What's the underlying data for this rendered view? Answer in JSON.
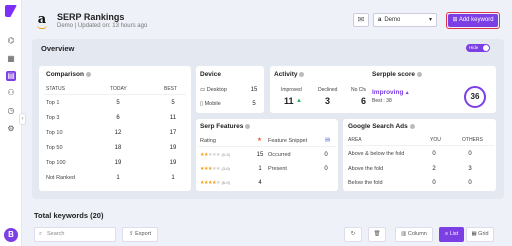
{
  "header": {
    "title": "SERP Rankings",
    "subtitle": "Demo | Updated on: 13 hours ago",
    "project_select": "Demo",
    "add_keyword_label": "Add keyword"
  },
  "overview": {
    "title": "Overview",
    "hide_label": "Hide"
  },
  "comparison": {
    "title": "Comparison",
    "headers": [
      "STATUS",
      "TODAY",
      "BEST"
    ],
    "rows": [
      {
        "status": "Top 1",
        "today": "5",
        "best": "5"
      },
      {
        "status": "Top 3",
        "today": "6",
        "best": "11"
      },
      {
        "status": "Top 10",
        "today": "12",
        "best": "17"
      },
      {
        "status": "Top 50",
        "today": "18",
        "best": "19"
      },
      {
        "status": "Top 100",
        "today": "19",
        "best": "19"
      },
      {
        "status": "Not Ranked",
        "today": "1",
        "best": "1"
      }
    ]
  },
  "device": {
    "title": "Device",
    "rows": [
      {
        "label": "Desktop",
        "value": "15"
      },
      {
        "label": "Mobile",
        "value": "5"
      }
    ]
  },
  "activity": {
    "title": "Activity",
    "improved_label": "Improved",
    "improved_value": "11",
    "declined_label": "Declined",
    "declined_value": "3",
    "nochange_label": "No Change",
    "nochange_value": "6"
  },
  "serpscore": {
    "title": "Serpple score",
    "status": "Improving",
    "best": "Best : 38",
    "score": "36"
  },
  "serp_features": {
    "title": "Serp Features",
    "rating_header": "Rating",
    "feature_header": "Feature Snippet",
    "rows": [
      {
        "range": "(0-3)",
        "count": "15",
        "label": "Occurred",
        "value": "0",
        "filled": 2
      },
      {
        "range": "(3-6)",
        "count": "1",
        "label": "Present",
        "value": "0",
        "filled": 3
      },
      {
        "range": "(6-9)",
        "count": "4",
        "filled": 4
      }
    ]
  },
  "google_ads": {
    "title": "Google Search Ads",
    "headers": [
      "AREA",
      "YOU",
      "OTHERS"
    ],
    "rows": [
      {
        "area": "Above & below the fold",
        "you": "0",
        "others": "0"
      },
      {
        "area": "Above the fold",
        "you": "2",
        "others": "3"
      },
      {
        "area": "Below the fold",
        "you": "0",
        "others": "0"
      }
    ]
  },
  "keywords": {
    "title": "Total keywords (20)",
    "search_placeholder": "Search",
    "export_label": "Export",
    "column_label": "Column",
    "list_label": "List",
    "grid_label": "Grid"
  },
  "sidebar": {
    "avatar": "B"
  },
  "colors": {
    "accent": "#7b3fe4",
    "improved": "#27ae60",
    "star": "#f0a020"
  }
}
